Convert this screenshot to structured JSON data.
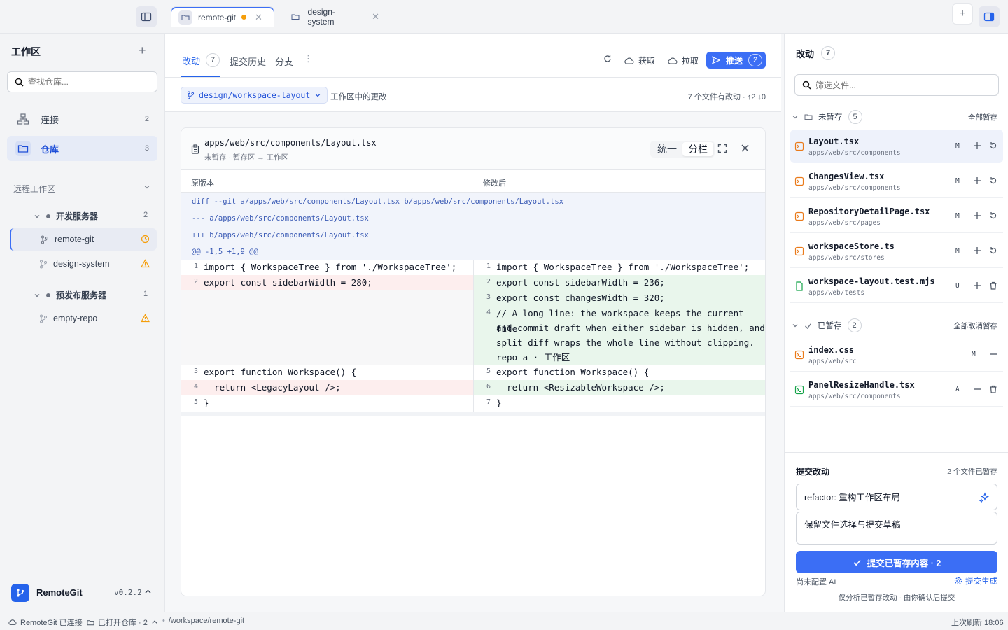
{
  "topbar": {
    "tabs": [
      {
        "label": "remote-git",
        "modified": true
      },
      {
        "label": "design-system",
        "modified": false
      }
    ],
    "new_tab_label": "+"
  },
  "sidebar": {
    "title": "工作区",
    "add_label": "+",
    "search_placeholder": "查找仓库...",
    "nav": [
      {
        "label": "连接",
        "count": "2"
      },
      {
        "label": "仓库",
        "count": "3"
      }
    ],
    "remote_section_label": "远程工作区",
    "groups": [
      {
        "label": "开发服务器",
        "count": "2"
      },
      {
        "label": "预发布服务器",
        "count": "1"
      }
    ],
    "repos": [
      {
        "label": "remote-git",
        "state": "clock-icon",
        "accent": "#f59e0b"
      },
      {
        "label": "design-system",
        "state": "warning-icon",
        "accent": "#f59e0b"
      },
      {
        "label": "empty-repo",
        "state": "warning-icon",
        "accent": "#f59e0b"
      }
    ],
    "brand": "RemoteGit",
    "version": "v0.2.2"
  },
  "main": {
    "tabs": [
      {
        "label": "改动",
        "count": "7"
      },
      {
        "label": "提交历史"
      },
      {
        "label": "分支"
      }
    ],
    "actions": {
      "fetch": "获取",
      "pull": "拉取",
      "push": "推送",
      "push_count": "2"
    },
    "branch": "design/workspace-layout",
    "branch_desc": "工作区中的更改",
    "stats": "7 个文件有改动 · ↑2 ↓0",
    "diff": {
      "path": "apps/web/src/components/Layout.tsx",
      "subtitle": "未暂存 · 暂存区 → 工作区",
      "view_unified": "统一",
      "view_split": "分栏",
      "col_left": "原版本",
      "col_right": "修改后",
      "meta": [
        "diff --git a/apps/web/src/components/Layout.tsx b/apps/web/src/components/Layout.tsx",
        "--- a/apps/web/src/components/Layout.tsx",
        "+++ b/apps/web/src/components/Layout.tsx",
        "@@ -1,5 +1,9 @@"
      ],
      "left": [
        {
          "n": "1",
          "code": "import { WorkspaceTree } from './WorkspaceTree';",
          "type": "ctx"
        },
        {
          "n": "2",
          "code": "export const sidebarWidth = 280;",
          "type": "del"
        },
        {
          "n": "3",
          "code": "export function Workspace() {",
          "type": "ctx"
        },
        {
          "n": "4",
          "code": "  return <LegacyLayout />;",
          "type": "del"
        },
        {
          "n": "5",
          "code": "}",
          "type": "ctx"
        }
      ],
      "right": [
        {
          "n": "1",
          "code": "import { WorkspaceTree } from './WorkspaceTree';",
          "type": "ctx"
        },
        {
          "n": "2",
          "code": "export const sidebarWidth = 236;",
          "type": "add"
        },
        {
          "n": "3",
          "code": "export const changesWidth = 320;",
          "type": "add"
        },
        {
          "n": "4",
          "code": "// A long line: the workspace keeps the current file",
          "type": "add"
        },
        {
          "n": "",
          "code": "and commit draft when either sidebar is hidden, and",
          "type": "add"
        },
        {
          "n": "",
          "code": "split diff wraps the whole line without clipping.",
          "type": "add"
        },
        {
          "n": "",
          "code": "repo-a · 工作区",
          "type": "add"
        },
        {
          "n": "5",
          "code": "export function Workspace() {",
          "type": "ctx"
        },
        {
          "n": "6",
          "code": "  return <ResizableWorkspace />;",
          "type": "add"
        },
        {
          "n": "7",
          "code": "}",
          "type": "ctx"
        }
      ]
    }
  },
  "changes": {
    "title": "改动",
    "count": "7",
    "filter_placeholder": "筛选文件...",
    "unstaged_label": "未暂存",
    "unstaged_count": "5",
    "stage_all": "全部暂存",
    "unstaged": [
      {
        "name": "Layout.tsx",
        "path": "apps/web/src/components",
        "status": "M"
      },
      {
        "name": "ChangesView.tsx",
        "path": "apps/web/src/components",
        "status": "M"
      },
      {
        "name": "RepositoryDetailPage.tsx",
        "path": "apps/web/src/pages",
        "status": "M"
      },
      {
        "name": "workspaceStore.ts",
        "path": "apps/web/src/stores",
        "status": "M"
      },
      {
        "name": "workspace-layout.test.mjs",
        "path": "apps/web/tests",
        "status": "U"
      }
    ],
    "staged_label": "已暂存",
    "staged_count": "2",
    "unstage_all": "全部取消暂存",
    "staged": [
      {
        "name": "index.css",
        "path": "apps/web/src",
        "status": "M"
      },
      {
        "name": "PanelResizeHandle.tsx",
        "path": "apps/web/src/components",
        "status": "A"
      }
    ]
  },
  "commit": {
    "title": "提交改动",
    "staged_info": "2 个文件已暂存",
    "summary": "refactor: 重构工作区布局",
    "description": "保留文件选择与提交草稿",
    "button": "提交已暂存内容 · 2",
    "ai_status": "尚未配置 AI",
    "generate": "提交生成",
    "hint": "仅分析已暂存改动 · 由你确认后提交"
  },
  "statusbar": {
    "connection": "RemoteGit 已连接",
    "open_repos": "已打开仓库 · 2",
    "path": "/workspace/remote-git",
    "refreshed": "上次刷新 18:06"
  },
  "colors": {
    "accent": "#3b6ef5",
    "added_bg": "#e9f6ec",
    "removed_bg": "#fdeeee",
    "warning": "#f59e0b"
  }
}
